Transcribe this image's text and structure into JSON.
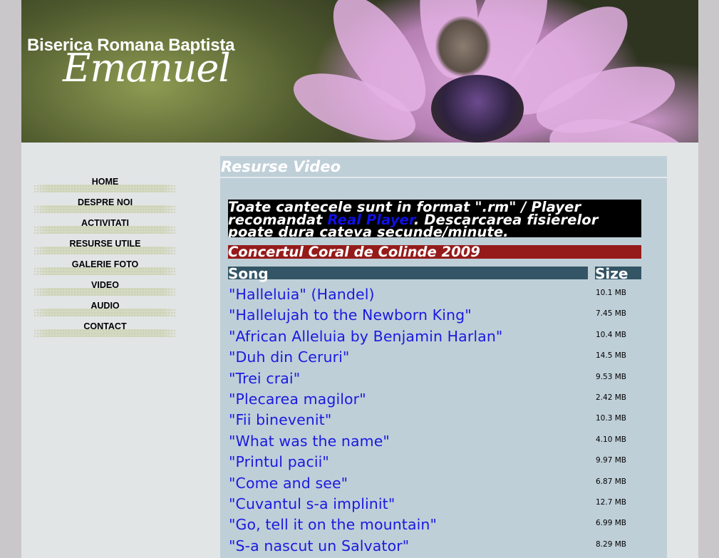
{
  "header": {
    "title": "Biserica Romana Baptista",
    "subtitle": "Emanuel"
  },
  "nav": {
    "items": [
      {
        "label": "HOME"
      },
      {
        "label": "DESPRE NOI"
      },
      {
        "label": "ACTIVITATI"
      },
      {
        "label": "RESURSE UTILE"
      },
      {
        "label": "GALERIE FOTO"
      },
      {
        "label": "VIDEO"
      },
      {
        "label": "AUDIO"
      },
      {
        "label": "CONTACT"
      }
    ]
  },
  "content": {
    "heading": "Resurse Video",
    "notice": {
      "before": "Toate cantecele sunt in format \".rm\" / Player recomandat ",
      "link": "Real Player",
      "after": ". Descarcarea fisierelor poate dura cateva secunde/minute."
    },
    "section_title": "Concertul Coral de Colinde 2009",
    "columns": {
      "song": "Song",
      "size": "Size"
    },
    "songs": [
      {
        "title": "\"Halleluia\" (Handel)",
        "size": "10.1 MB"
      },
      {
        "title": "\"Hallelujah to the Newborn King\"",
        "size": "7.45 MB"
      },
      {
        "title": "\"African Alleluia by Benjamin Harlan\"",
        "size": "10.4 MB"
      },
      {
        "title": "\"Duh din Ceruri\"",
        "size": "14.5 MB"
      },
      {
        "title": "\"Trei crai\"",
        "size": "9.53 MB"
      },
      {
        "title": "\"Plecarea magilor\"",
        "size": "2.42 MB"
      },
      {
        "title": "\"Fii binevenit\"",
        "size": "10.3 MB"
      },
      {
        "title": "\"What was the name\"",
        "size": "4.10 MB"
      },
      {
        "title": "\"Printul pacii\"",
        "size": "9.97 MB"
      },
      {
        "title": "\"Come and see\"",
        "size": "6.87 MB"
      },
      {
        "title": "\"Cuvantul s-a implinit\"",
        "size": "12.7 MB"
      },
      {
        "title": "\"Go, tell it on the mountain\"",
        "size": "6.99 MB"
      },
      {
        "title": "\"S-a nascut un Salvator\"",
        "size": "8.29 MB"
      }
    ]
  },
  "colors": {
    "page_bg": "#c9c7ca",
    "content_bg": "#bfcfd8",
    "notice_bg": "#000000",
    "section_bg": "#951b1b",
    "column_header_bg": "#335566",
    "link": "#1a1ae0"
  }
}
